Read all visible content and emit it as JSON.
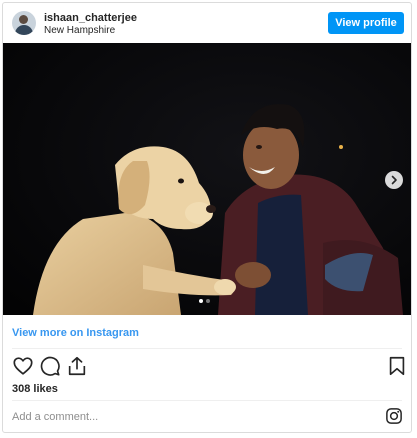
{
  "post": {
    "username": "ishaan_chatterjee",
    "location": "New Hampshire",
    "view_profile_label": "View profile",
    "carousel": {
      "current_slide": 1,
      "total_slides": 2
    },
    "view_more_label": "View more on Instagram",
    "likes_text": "308 likes",
    "comment_placeholder": "Add a comment...",
    "icons": {
      "avatar": "profile-avatar",
      "next": "chevron-right-icon",
      "like": "heart-icon",
      "comment": "comment-bubble-icon",
      "share": "share-icon",
      "save": "bookmark-icon",
      "brand": "instagram-icon"
    },
    "colors": {
      "accent": "#0095f6",
      "link": "#3897f0",
      "border": "#dbdbdb",
      "text": "#262626",
      "muted": "#8e8e8e"
    }
  }
}
